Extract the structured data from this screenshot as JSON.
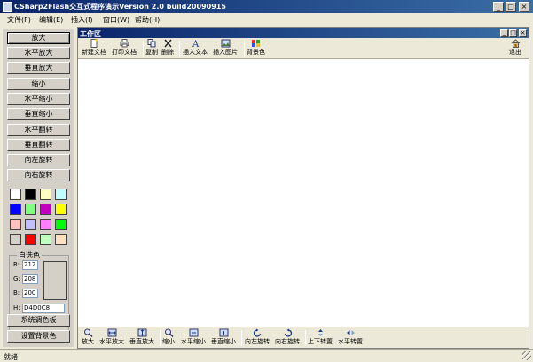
{
  "window": {
    "title": "CSharp2Flash交互式程序演示Version 2.0 build20090915"
  },
  "menubar": {
    "items": [
      "文件(F)",
      "编辑(E)",
      "插入(I)",
      "窗口(W)",
      "帮助(H)"
    ]
  },
  "left_panel": {
    "buttons": [
      "放大",
      "水平放大",
      "垂直放大",
      "缩小",
      "水平缩小",
      "垂直缩小",
      "水平翻转",
      "垂直翻转",
      "向左旋转",
      "向右旋转"
    ],
    "swatch_colors": [
      "#ffffff",
      "#000000",
      "#ffffc0",
      "#c0ffff",
      "#0000ff",
      "#80ff80",
      "#c000c0",
      "#ffff00",
      "#ffc0c0",
      "#c0c0ff",
      "#ff80ff",
      "#00ff00",
      "#d4d0c8",
      "#ff0000",
      "#c0ffc0",
      "#ffe0c0"
    ],
    "custom_color": {
      "legend": "自选色",
      "r_label": "R:",
      "r_value": "212",
      "g_label": "G:",
      "g_value": "208",
      "b_label": "B:",
      "b_value": "200",
      "h_label": "H:",
      "h_value": "D4D0C8"
    },
    "system_palette_button": "系统调色板",
    "set_background_button": "设置背景色"
  },
  "workspace": {
    "title": "工作区",
    "top_toolbar": [
      "新建文档",
      "打印文档",
      "复制",
      "删除",
      "插入文本",
      "插入图片",
      "背景色"
    ],
    "exit_label": "退出",
    "bottom_toolbar": [
      "放大",
      "水平放大",
      "垂直放大",
      "缩小",
      "水平缩小",
      "垂直缩小",
      "向左旋转",
      "向右旋转",
      "上下转置",
      "水平转置"
    ]
  },
  "statusbar": {
    "text": "就绪"
  },
  "colors": {
    "title_gradient_start": "#0a246a",
    "title_gradient_end": "#3a6ea5",
    "face": "#d4d0c8",
    "canvas": "#ffffff"
  }
}
